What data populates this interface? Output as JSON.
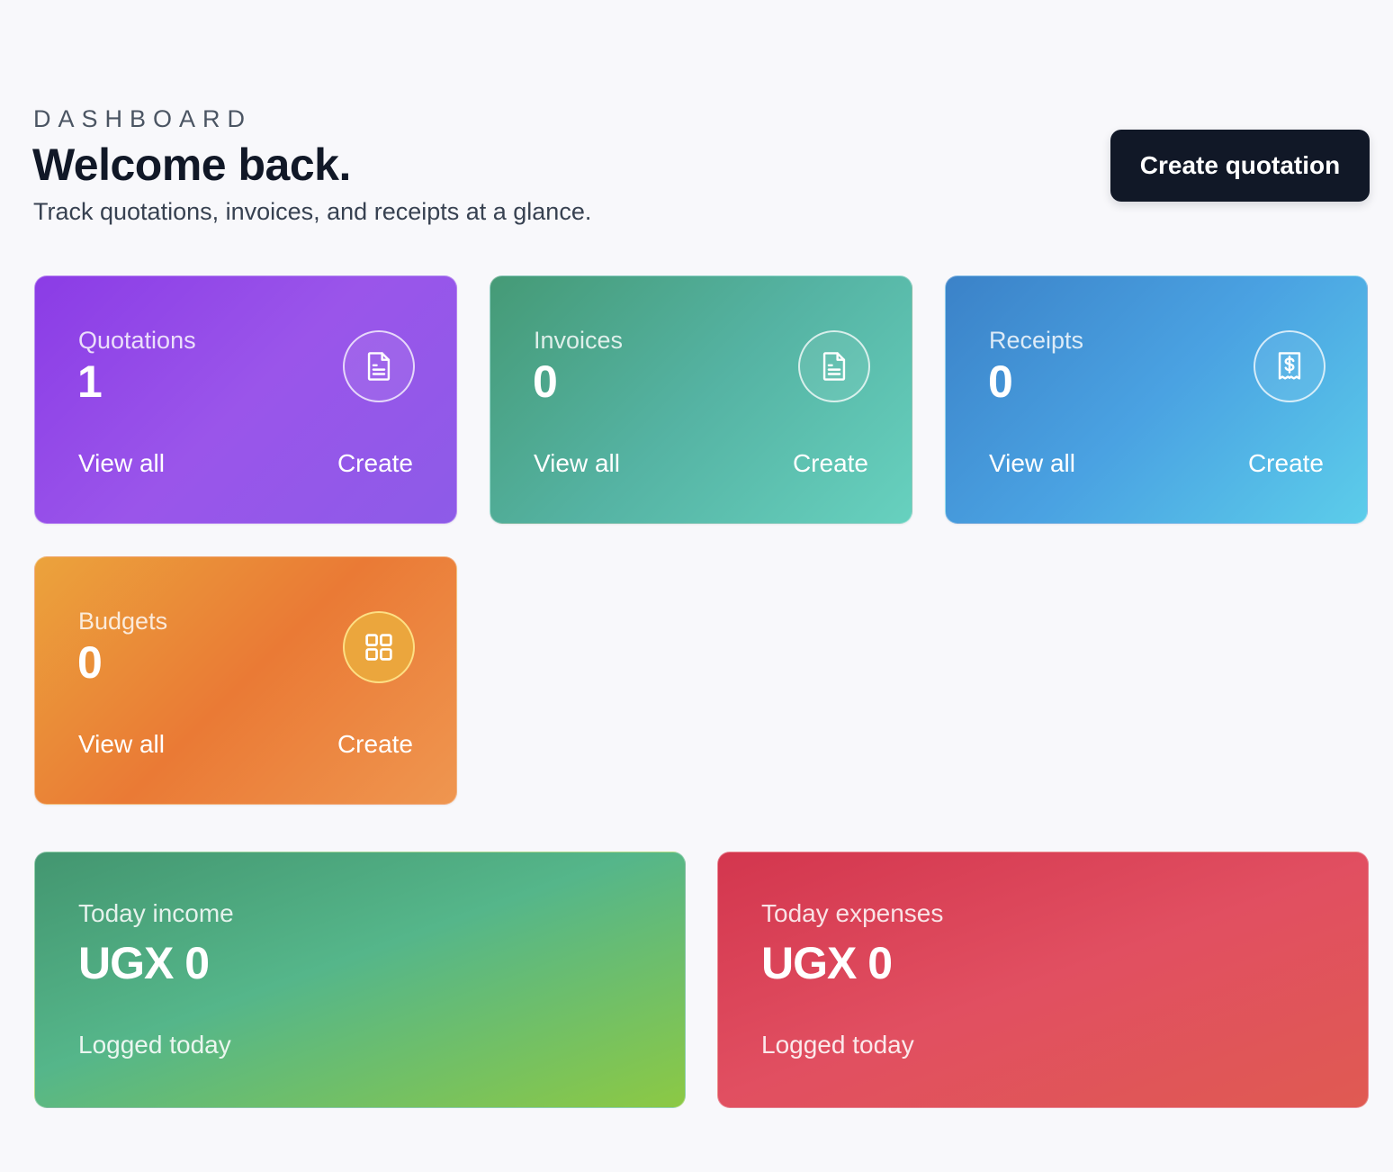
{
  "header": {
    "eyebrow": "DASHBOARD",
    "title": "Welcome back.",
    "subtitle": "Track quotations, invoices, and receipts at a glance.",
    "primary_action": "Create quotation"
  },
  "cards": [
    {
      "label": "Quotations",
      "count": "1",
      "icon": "document-icon",
      "view_label": "View all",
      "create_label": "Create",
      "color_start": "#8b3ce6",
      "color_end": "#8d5be8"
    },
    {
      "label": "Invoices",
      "count": "0",
      "icon": "document-icon",
      "view_label": "View all",
      "create_label": "Create",
      "color_start": "#459a76",
      "color_end": "#67d1bf"
    },
    {
      "label": "Receipts",
      "count": "0",
      "icon": "receipt-dollar-icon",
      "view_label": "View all",
      "create_label": "Create",
      "color_start": "#3b82c8",
      "color_end": "#5ccdea"
    },
    {
      "label": "Budgets",
      "count": "0",
      "icon": "grid-icon",
      "view_label": "View all",
      "create_label": "Create",
      "color_start": "#eba33c",
      "color_end": "#ef9650"
    }
  ],
  "stats": {
    "income": {
      "label": "Today income",
      "value": "UGX 0",
      "note": "Logged today",
      "color_start": "#439670",
      "color_end": "#8cc944"
    },
    "expenses": {
      "label": "Today expenses",
      "value": "UGX 0",
      "note": "Logged today",
      "color_start": "#d3364e",
      "color_end": "#e05a52"
    }
  }
}
